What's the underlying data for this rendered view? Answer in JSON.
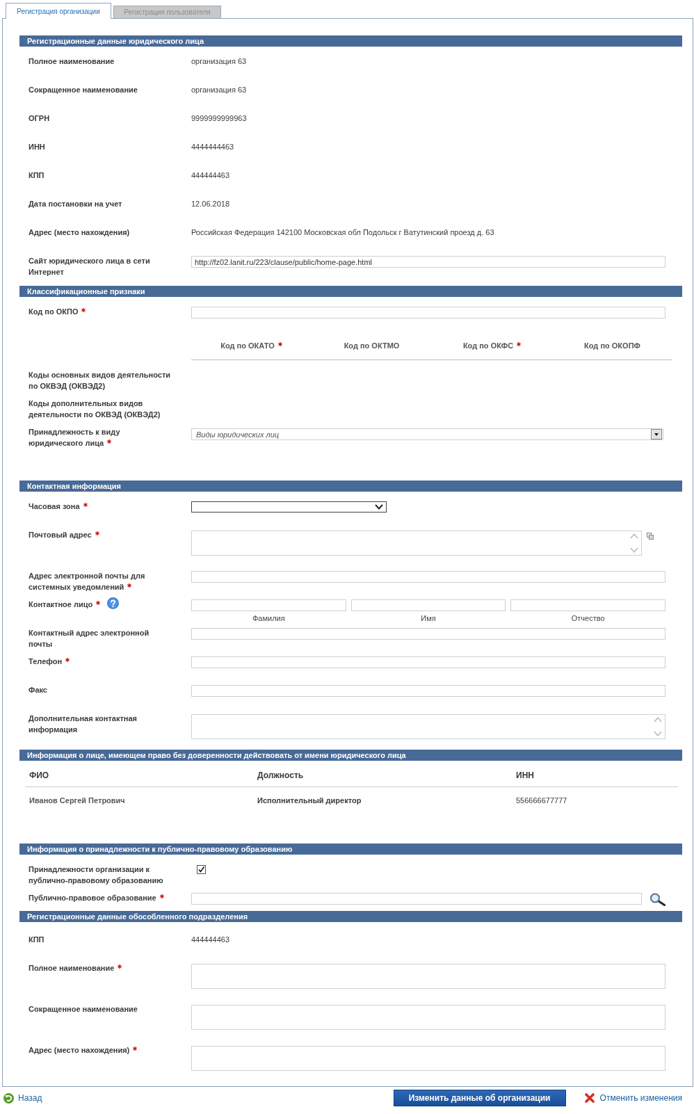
{
  "tabs": [
    {
      "label": "Регистрация организации",
      "selected": true
    },
    {
      "label": "Регистрация пользователя",
      "selected": false
    }
  ],
  "sections": [
    {
      "title": "Регистрационные данные юридического лица",
      "rows": [
        {
          "kind": "text",
          "label": "Полное наименование",
          "value": "организация 63"
        },
        {
          "kind": "text",
          "label": "Сокращенное наименование",
          "value": "организация 63"
        },
        {
          "kind": "text",
          "label": "ОГРН",
          "value": "9999999999963"
        },
        {
          "kind": "text",
          "label": "ИНН",
          "value": "4444444463"
        },
        {
          "kind": "text",
          "label": "КПП",
          "value": "444444463"
        },
        {
          "kind": "text",
          "label": "Дата постановки на учет",
          "value": "12.06.2018"
        },
        {
          "kind": "text",
          "label": "Адрес (место нахождения)",
          "value": "Российская Федерация 142100 Московская обл Подольск г Ватутинский проезд д. 63"
        },
        {
          "kind": "input",
          "label": "Сайт юридического лица в сети Интернет",
          "value": "http://fz02.lanit.ru/223/clause/public/home-page.html"
        }
      ]
    },
    {
      "title": "Классификационные признаки",
      "rows": [
        {
          "kind": "input",
          "label": "Код по ОКПО",
          "required": true
        },
        {
          "kind": "codes",
          "columns": [
            {
              "label": "Код по ОКАТО",
              "required": true
            },
            {
              "label": "Код по ОКТМО",
              "required": false
            },
            {
              "label": "Код по ОКФС",
              "required": true
            },
            {
              "label": "Код по ОКОПФ",
              "required": false
            }
          ]
        },
        {
          "kind": "empty",
          "label": "Коды основных видов деятельности по ОКВЭД (ОКВЭД2)"
        },
        {
          "kind": "empty",
          "label": "Коды дополнительных видов деятельности по ОКВЭД (ОКВЭД2)"
        },
        {
          "kind": "combo",
          "label": "Принадлежность к виду юридического лица",
          "required": true,
          "placeholder": "Виды юридических лиц"
        }
      ]
    },
    {
      "title": "Контактная информация",
      "rows": [
        {
          "kind": "select",
          "label": "Часовая зона",
          "required": true
        },
        {
          "kind": "address",
          "label": "Почтовый адрес",
          "required": true
        },
        {
          "kind": "input",
          "label": "Адрес электронной почты для системных уведомлений",
          "required": true
        },
        {
          "kind": "person",
          "label": "Контактное лицо",
          "required": true,
          "parts": [
            {
              "caption": "Фамилия"
            },
            {
              "caption": "Имя"
            },
            {
              "caption": "Отчество"
            }
          ]
        },
        {
          "kind": "input",
          "label": "Контактный адрес электронной почты",
          "required": false
        },
        {
          "kind": "input",
          "label": "Телефон",
          "required": true
        },
        {
          "kind": "input",
          "label": "Факс",
          "required": false
        },
        {
          "kind": "scrolltext",
          "label": "Дополнительная контактная информация",
          "required": false
        }
      ]
    },
    {
      "title": "Информация о лице, имеющем право без доверенности действовать от имени юридического лица",
      "table": {
        "columns": [
          "ФИО",
          "Должность",
          "ИНН"
        ],
        "rows": [
          [
            "Иванов Сергей Петрович",
            "Исполнительный директор",
            "556666677777"
          ]
        ]
      }
    },
    {
      "title": "Информация о принадлежности к публично-правовому образованию",
      "rows": [
        {
          "kind": "checkbox",
          "label": "Принадлежности организации к публично-правовому образованию",
          "checked": true
        },
        {
          "kind": "lookup",
          "label": "Публично-правовое образование",
          "required": true
        }
      ]
    },
    {
      "title": "Регистрационные данные обособленного подразделения",
      "rows": [
        {
          "kind": "text",
          "label": "КПП",
          "value": "444444463"
        },
        {
          "kind": "textarea",
          "label": "Полное наименование",
          "required": true
        },
        {
          "kind": "textarea",
          "label": "Сокращенное наименование",
          "required": false
        },
        {
          "kind": "textarea",
          "label": "Адрес (место нахождения)",
          "required": true
        }
      ]
    }
  ],
  "footer": {
    "back_link": "Назад",
    "submit_button": "Изменить данные об организации",
    "cancel_link": "Отменить изменения"
  }
}
